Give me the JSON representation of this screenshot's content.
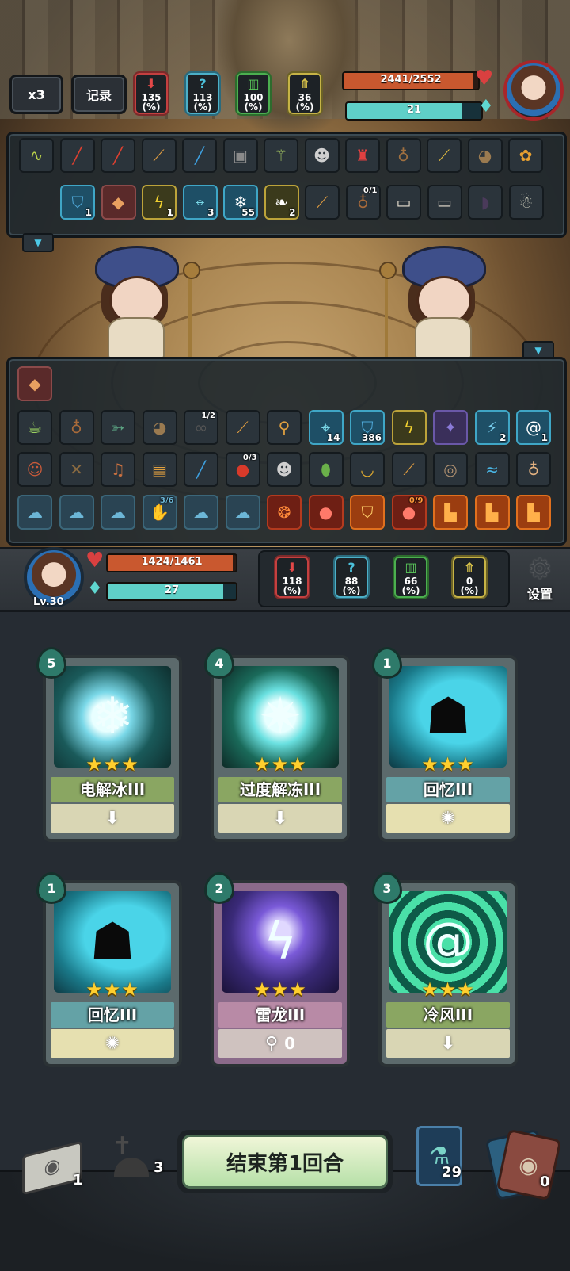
{
  "top_hud": {
    "speed_label": "x3",
    "log_label": "记录",
    "enemy_stats": [
      {
        "value": "135",
        "unit": "(%)",
        "color": "red",
        "icon": "attack-down-icon"
      },
      {
        "value": "113",
        "unit": "(%)",
        "color": "blue",
        "icon": "question-icon"
      },
      {
        "value": "100",
        "unit": "(%)",
        "color": "green",
        "icon": "defense-icon"
      },
      {
        "value": "36",
        "unit": "(%)",
        "color": "yellow",
        "icon": "speed-icon"
      }
    ],
    "enemy_hp": "2441/2552",
    "enemy_hp_fraction": 0.956,
    "enemy_mana": "21",
    "enemy_mana_fraction": 0.85
  },
  "enemy_items_row1": [
    "whip-icon",
    "cane-red-icon",
    "cane-red-icon",
    "horn-icon",
    "cane-blue-icon",
    "lantern-icon",
    "staff-icon",
    "mask-icon",
    "demon-icon",
    "bag-icon",
    "horn-gold-icon",
    "owl-icon",
    "flower-icon"
  ],
  "enemy_items_row2": [
    {
      "icon": "shield-icon",
      "count": "1"
    },
    {
      "icon": "crystal-icon",
      "count": ""
    },
    {
      "icon": "lightning-icon",
      "count": "1"
    },
    {
      "icon": "target-icon",
      "count": "3"
    },
    {
      "icon": "snowflake-icon",
      "count": "55"
    },
    {
      "icon": "wing-icon",
      "count": "2"
    },
    {
      "icon": "horn-icon",
      "count": ""
    },
    {
      "icon": "pouch-icon",
      "count": "",
      "top": "0/1"
    },
    {
      "icon": "scroll-icon",
      "count": ""
    },
    {
      "icon": "scroll-icon",
      "count": ""
    },
    {
      "icon": "cloak-icon",
      "count": ""
    },
    {
      "icon": "ghost-icon",
      "count": ""
    }
  ],
  "player_items_row1": [
    {
      "icon": "teacup-icon",
      "count": ""
    },
    {
      "icon": "pouch-icon",
      "count": ""
    },
    {
      "icon": "fish-icon",
      "count": ""
    },
    {
      "icon": "owl-icon",
      "count": ""
    },
    {
      "icon": "binoculars-icon",
      "count": "",
      "top": "1/2"
    },
    {
      "icon": "horn-icon",
      "count": ""
    },
    {
      "icon": "brush-icon",
      "count": ""
    },
    {
      "icon": "target-icon",
      "count": "14"
    },
    {
      "icon": "shield-icon",
      "count": "386"
    },
    {
      "icon": "lightning-icon",
      "count": ""
    },
    {
      "icon": "rune-icon",
      "count": ""
    },
    {
      "icon": "storm-icon",
      "count": "2"
    },
    {
      "icon": "spiral-icon",
      "count": "1"
    }
  ],
  "player_items_row2": [
    {
      "icon": "doll-icon",
      "count": ""
    },
    {
      "icon": "crossbow-icon",
      "count": ""
    },
    {
      "icon": "bell-icon",
      "count": ""
    },
    {
      "icon": "card-icon",
      "count": ""
    },
    {
      "icon": "cane-blue-icon",
      "count": ""
    },
    {
      "icon": "berry-icon",
      "count": "",
      "top": "0/3"
    },
    {
      "icon": "mask-icon",
      "count": ""
    },
    {
      "icon": "jar-icon",
      "count": ""
    },
    {
      "icon": "bowl-icon",
      "count": ""
    },
    {
      "icon": "horn-icon",
      "count": ""
    },
    {
      "icon": "shell-icon",
      "count": ""
    },
    {
      "icon": "wave-icon",
      "count": ""
    },
    {
      "icon": "sack-icon",
      "count": ""
    }
  ],
  "player_items_row3": [
    {
      "icon": "skill-ghost-icon",
      "count": ""
    },
    {
      "icon": "skill-ghost-icon",
      "count": ""
    },
    {
      "icon": "skill-ghost-icon",
      "count": ""
    },
    {
      "icon": "skill-hand-icon",
      "count": "",
      "top": "3/6"
    },
    {
      "icon": "skill-ghost-icon",
      "count": ""
    },
    {
      "icon": "skill-ghost-icon",
      "count": ""
    },
    {
      "icon": "fire-swirl-icon",
      "count": ""
    },
    {
      "icon": "fire-blob-icon",
      "count": ""
    },
    {
      "icon": "fire-shield-icon",
      "count": ""
    },
    {
      "icon": "fire-blob-icon",
      "count": "",
      "top": "0/9"
    },
    {
      "icon": "fire-boot-icon",
      "count": ""
    },
    {
      "icon": "fire-boot-icon",
      "count": ""
    },
    {
      "icon": "fire-boot-icon",
      "count": ""
    }
  ],
  "player_hud": {
    "level": "Lv.30",
    "hp": "1424/1461",
    "hp_fraction": 0.975,
    "mana": "27",
    "mana_fraction": 0.9,
    "stats": [
      {
        "value": "118",
        "unit": "(%)",
        "color": "red"
      },
      {
        "value": "88",
        "unit": "(%)",
        "color": "blue"
      },
      {
        "value": "66",
        "unit": "(%)",
        "color": "green"
      },
      {
        "value": "0",
        "unit": "(%)",
        "color": "yellow"
      }
    ],
    "settings_label": "设置"
  },
  "cards": [
    {
      "cost": "5",
      "name": "电解冰III",
      "stars": 3,
      "theme": "green",
      "art": "ice-lightning",
      "foot": ""
    },
    {
      "cost": "4",
      "name": "过度解冻III",
      "stars": 3,
      "theme": "green",
      "art": "ice-burst",
      "foot": ""
    },
    {
      "cost": "1",
      "name": "回忆III",
      "stars": 3,
      "theme": "teal",
      "art": "memory",
      "foot": ""
    },
    {
      "cost": "1",
      "name": "回忆III",
      "stars": 3,
      "theme": "teal",
      "art": "memory",
      "foot": ""
    },
    {
      "cost": "2",
      "name": "雷龙III",
      "stars": 3,
      "theme": "pink",
      "art": "thunder-dragon",
      "foot": "0"
    },
    {
      "cost": "3",
      "name": "冷风III",
      "stars": 3,
      "theme": "green",
      "art": "cold-wind",
      "foot": ""
    }
  ],
  "bottom": {
    "draw_pile_count": "1",
    "grave_count": "3",
    "end_turn_label": "结束第1回合",
    "potion_count": "29",
    "discard_count": "0"
  }
}
